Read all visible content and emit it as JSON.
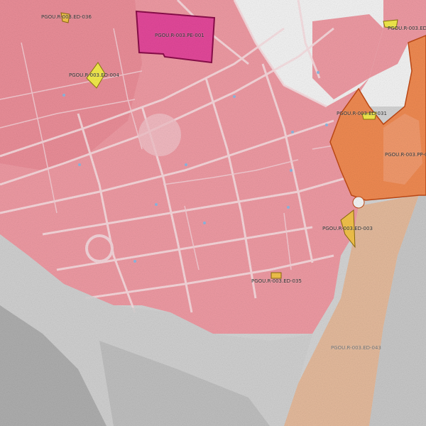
{
  "map": {
    "colors": {
      "base": "#d6d6d6",
      "urban_zone": "#ef9ea6",
      "urban_zone_dark": "#e7838e",
      "streets": "#f6d9dd",
      "equipment_zone": "#e14f9e",
      "equipment_zone_border": "#8a0f4a",
      "orange_zone": "#f08d55",
      "orange_zone_border": "#c04a14",
      "tan_zone": "#e6b898",
      "yellow_parcel": "#f0e64a",
      "water_dots": "#8fb7df"
    },
    "labels": {
      "ed_036": "PGOU.R-003.ED-036",
      "pe_001": "PGOU.R-003.PE-001",
      "ed_top_right": "PGOU.R-003.ED-",
      "ed_004": "PGOU.R-003.ED-004",
      "ed_031": "PGOU.R-003.ED-031",
      "pp_right": "PGOU.R-003.PP-0",
      "ed_003": "PGOU.R-003.ED-003",
      "ed_center_bottom": "PGOU.R-003.ED-035",
      "ed_bottom_faded": "PGOU.R-003.ED-043"
    }
  }
}
